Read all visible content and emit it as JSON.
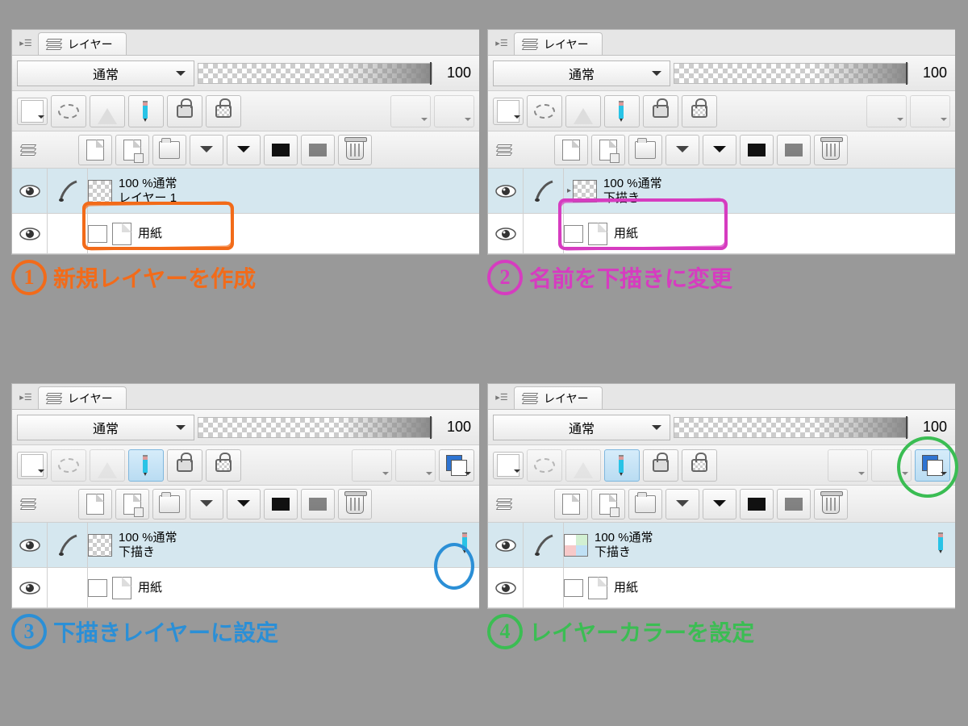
{
  "tab_label": "レイヤー",
  "blend_mode": "通常",
  "opacity_value": "100",
  "layer_opacity_label": "100 %通常",
  "paper_layer_name": "用紙",
  "panels": {
    "p1": {
      "selected_layer_name": "レイヤー 1",
      "color_swatch_present": false
    },
    "p2": {
      "selected_layer_name": "下描き",
      "color_swatch_present": false
    },
    "p3": {
      "selected_layer_name": "下描き",
      "color_swatch_present": true,
      "thumb_variant": "transparent"
    },
    "p4": {
      "selected_layer_name": "下描き",
      "color_swatch_present": true,
      "thumb_variant": "color",
      "layer_color_active": true
    }
  },
  "annotations": {
    "a1": {
      "num": "1",
      "text": "新規レイヤーを作成",
      "color": "#f26b1a"
    },
    "a2": {
      "num": "2",
      "text": "名前を下描きに変更",
      "color": "#d63cc0"
    },
    "a3": {
      "num": "3",
      "text": "下描きレイヤーに設定",
      "color": "#2b8fd6"
    },
    "a4": {
      "num": "4",
      "text": "レイヤーカラーを設定",
      "color": "#3bbd53"
    }
  }
}
